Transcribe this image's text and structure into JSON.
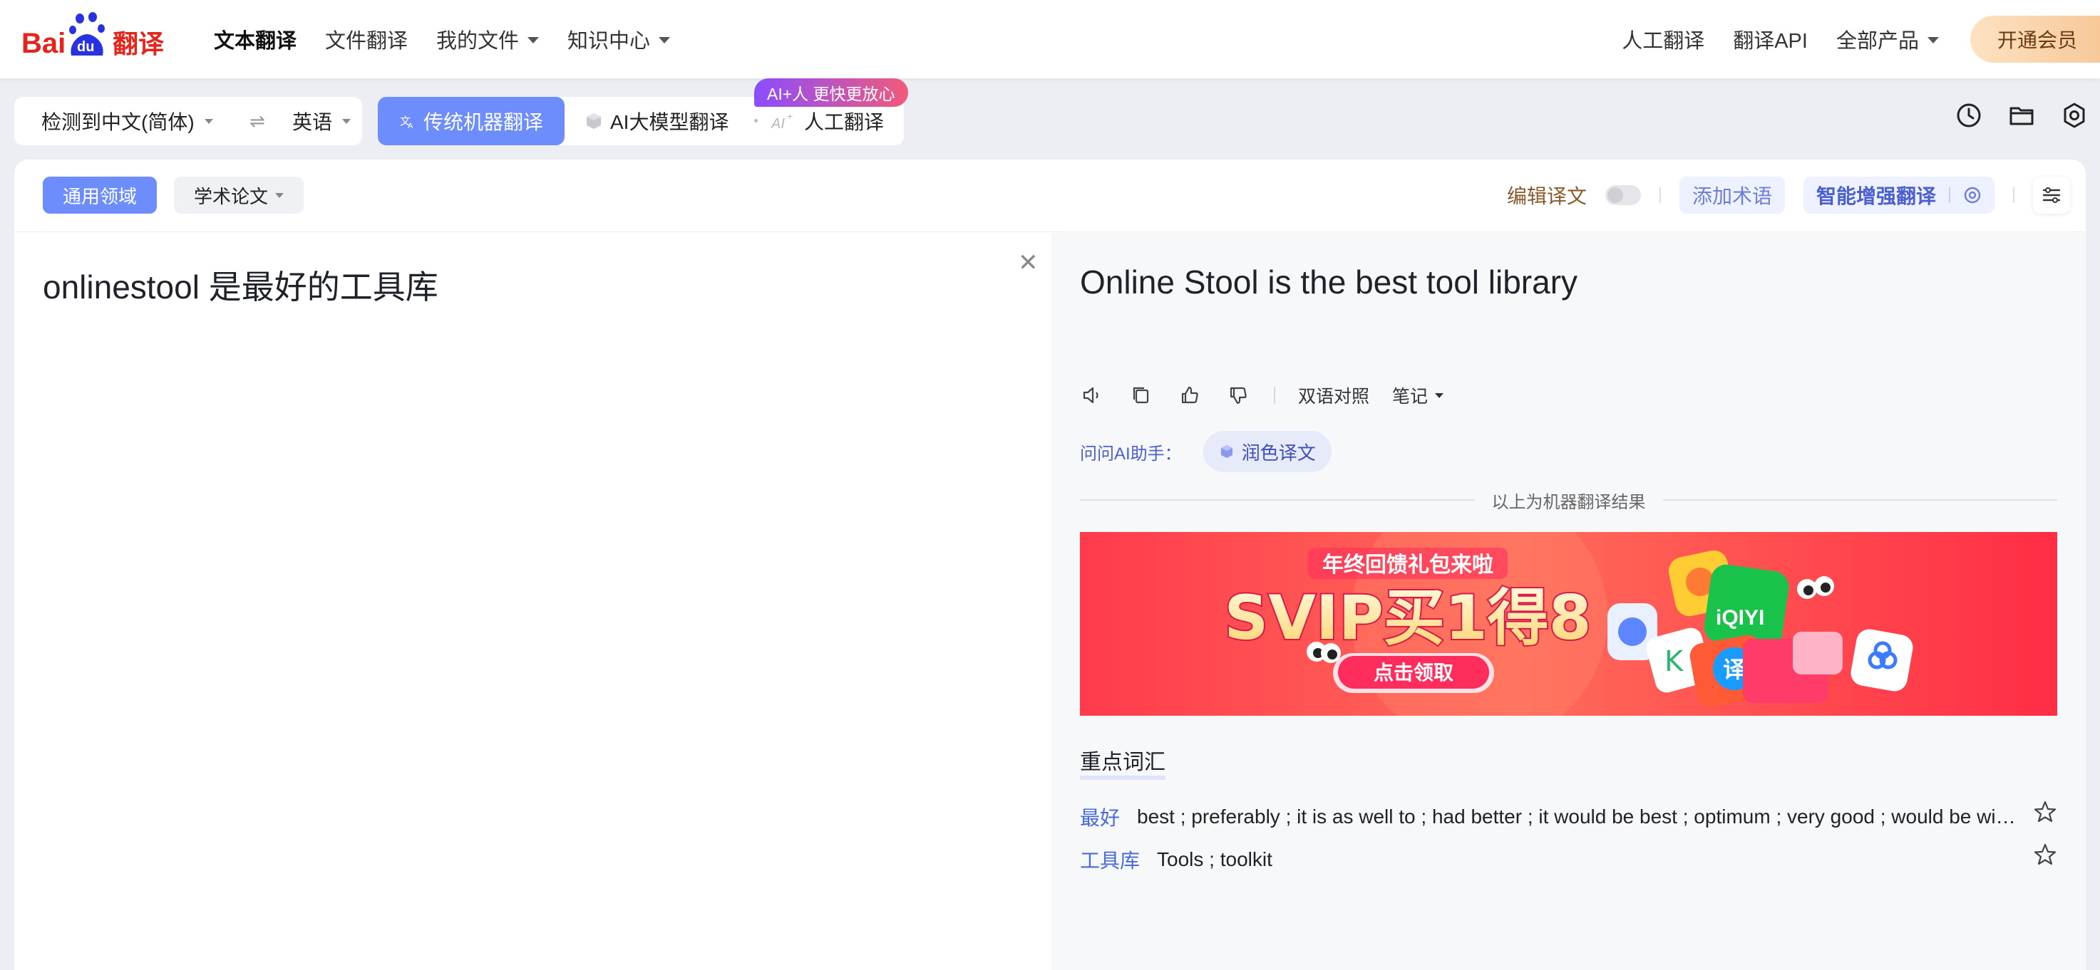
{
  "brand": {
    "logo_text_1": "Bai",
    "logo_text_2": "du",
    "logo_text_3": "翻译",
    "red": "#e5241c",
    "blue": "#2932e1"
  },
  "nav": {
    "left": [
      {
        "label": "文本翻译",
        "active": true,
        "dropdown": false
      },
      {
        "label": "文件翻译",
        "active": false,
        "dropdown": false
      },
      {
        "label": "我的文件",
        "active": false,
        "dropdown": true
      },
      {
        "label": "知识中心",
        "active": false,
        "dropdown": true
      }
    ],
    "right": [
      {
        "label": "人工翻译",
        "dropdown": false
      },
      {
        "label": "翻译API",
        "dropdown": false
      },
      {
        "label": "全部产品",
        "dropdown": true
      }
    ],
    "vip_label": "开通会员"
  },
  "lang": {
    "source": "检测到中文(简体)",
    "swap": "⇌",
    "target": "英语"
  },
  "modes": {
    "machine": "传统机器翻译",
    "ai": "AI大模型翻译",
    "human": "人工翻译",
    "promo": "AI+人 更快更放心"
  },
  "toolbar_icons": [
    "history-icon",
    "folder-icon",
    "settings-icon"
  ],
  "domains": {
    "general": "通用领域",
    "academic": "学术论文"
  },
  "options": {
    "edit": "编辑译文",
    "terms": "添加术语",
    "enhance": "智能增强翻译"
  },
  "source_text": "onlinestool 是最好的工具库",
  "target_text": "Online Stool is the best tool library",
  "actions": {
    "bilingual": "双语对照",
    "notes": "笔记"
  },
  "ask_ai": {
    "label": "问问AI助手：",
    "polish": "润色译文"
  },
  "machine_note": "以上为机器翻译结果",
  "banner": {
    "headline": "年终回馈礼包来啦",
    "main": "SVIP买1得8",
    "cta": "点击领取",
    "iqiyi": "iQIYI",
    "yi": "译"
  },
  "vocab": {
    "title": "重点词汇",
    "items": [
      {
        "word": "最好",
        "def": "best ; preferably ; it is as well to ; had better ; it would be best ; optimum ; very good ; would be wise to"
      },
      {
        "word": "工具库",
        "def": "Tools ; toolkit"
      }
    ]
  },
  "colors": {
    "accent": "#6c8dfb",
    "link": "#4a6bd6",
    "banner_bg": "#ff3d4f"
  }
}
